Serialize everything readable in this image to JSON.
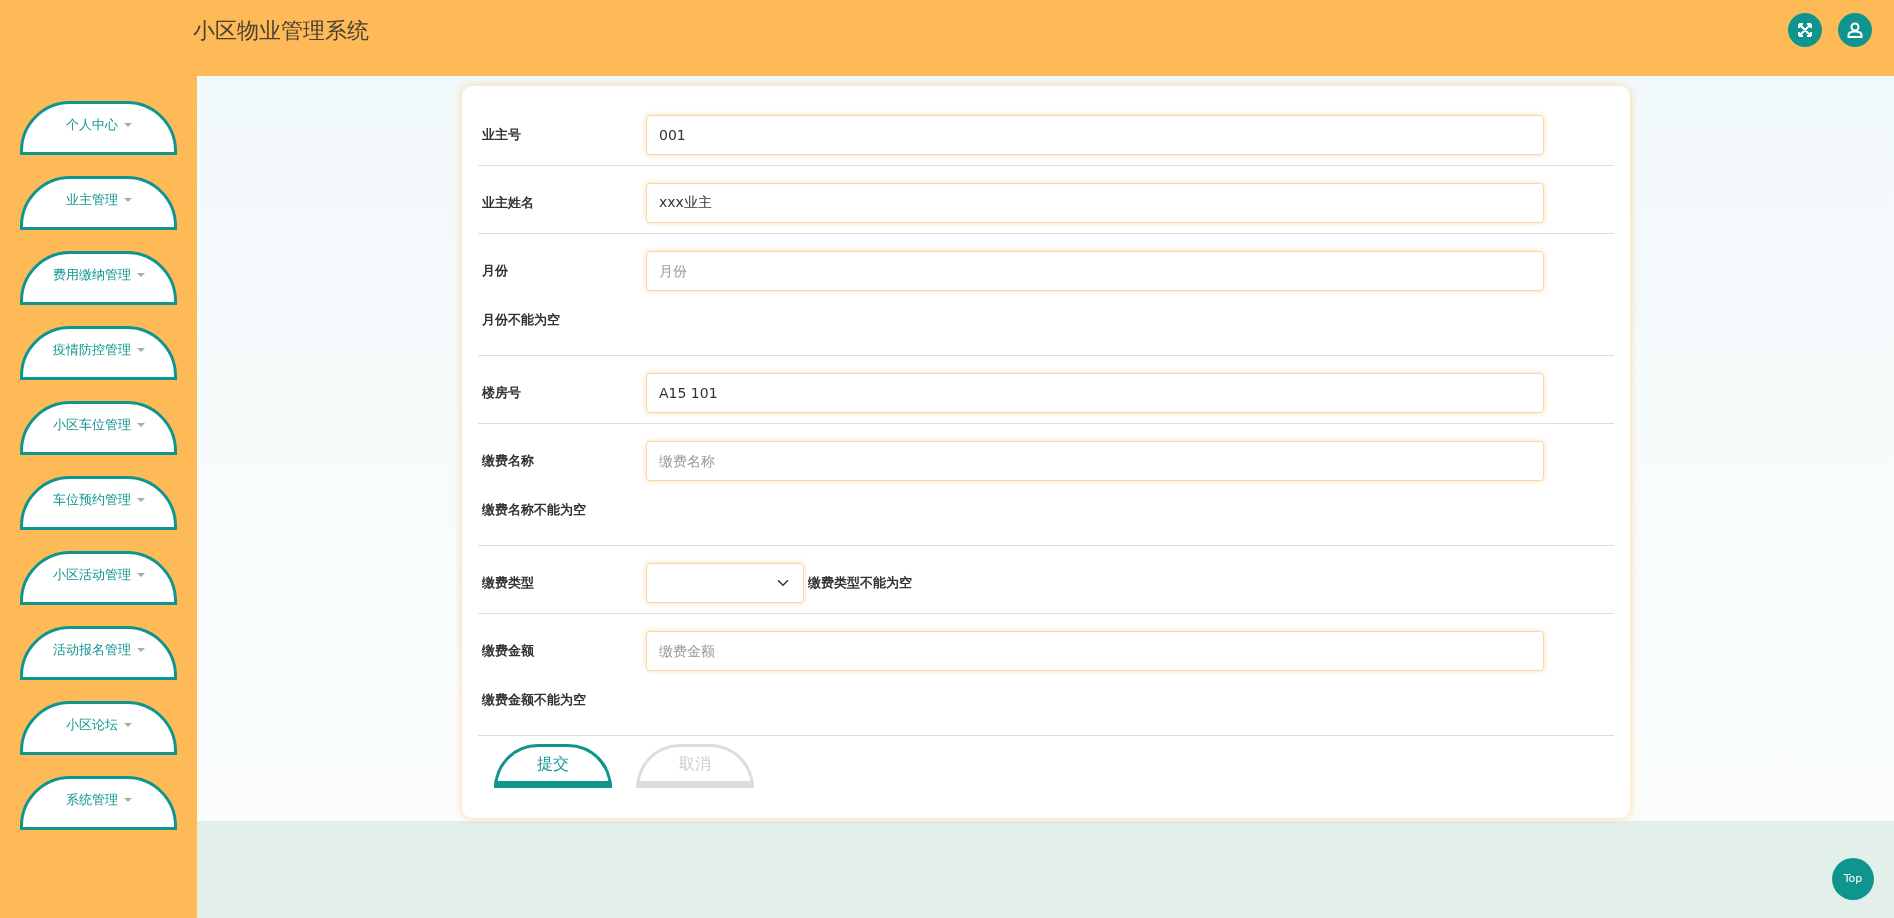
{
  "header": {
    "title": "小区物业管理系统"
  },
  "sidebar": {
    "items": [
      {
        "label": "个人中心"
      },
      {
        "label": "业主管理"
      },
      {
        "label": "费用缴纳管理"
      },
      {
        "label": "疫情防控管理"
      },
      {
        "label": "小区车位管理"
      },
      {
        "label": "车位预约管理"
      },
      {
        "label": "小区活动管理"
      },
      {
        "label": "活动报名管理"
      },
      {
        "label": "小区论坛"
      },
      {
        "label": "系统管理"
      }
    ]
  },
  "form": {
    "fields": [
      {
        "kind": "input",
        "label": "业主号",
        "value": "001"
      },
      {
        "kind": "input",
        "label": "业主姓名",
        "value": "xxx业主"
      },
      {
        "kind": "input",
        "label": "月份",
        "placeholder": "月份",
        "error": "月份不能为空"
      },
      {
        "kind": "input",
        "label": "楼房号",
        "value": "A15 101"
      },
      {
        "kind": "input",
        "label": "缴费名称",
        "placeholder": "缴费名称",
        "error": "缴费名称不能为空"
      },
      {
        "kind": "select",
        "label": "缴费类型",
        "error": "缴费类型不能为空"
      },
      {
        "kind": "input",
        "label": "缴费金额",
        "placeholder": "缴费金额",
        "error": "缴费金额不能为空"
      }
    ],
    "buttons": [
      {
        "label": "提交",
        "kind": "primary"
      },
      {
        "label": "取消",
        "kind": "secondary"
      }
    ]
  },
  "back_to_top": {
    "label": "Top"
  }
}
